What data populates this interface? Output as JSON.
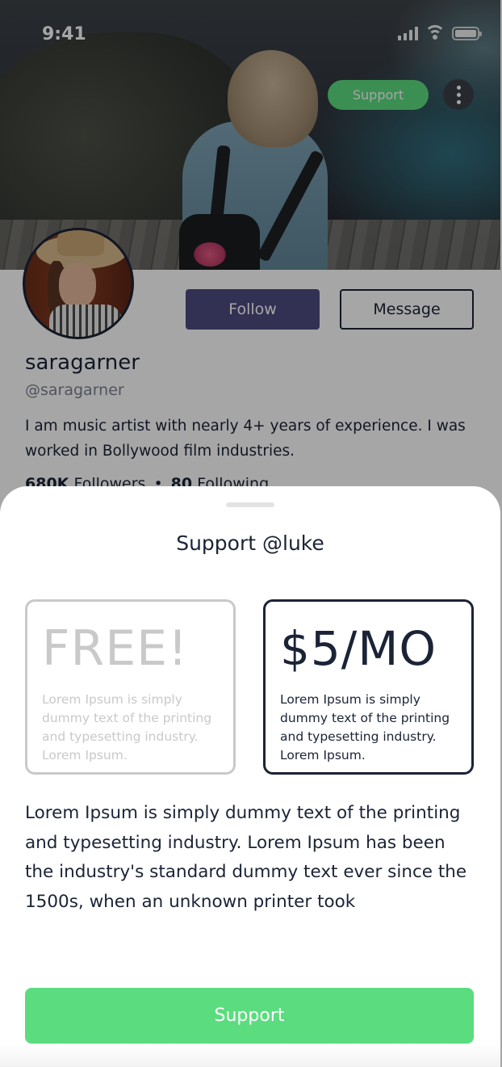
{
  "status_bar": {
    "time": "9:41"
  },
  "cover": {
    "support_label": "Support"
  },
  "profile": {
    "follow_label": "Follow",
    "message_label": "Message",
    "name": "saragarner",
    "handle": "@saragarner",
    "bio": "I am music artist with nearly 4+ years of experience. I was worked in Bollywood film industries.",
    "followers": "680K",
    "followers_label": "Followers",
    "separator": "•",
    "following": "80",
    "following_label": "Following"
  },
  "sheet": {
    "title": "Support @luke",
    "plans": [
      {
        "price": "FREE!",
        "description": "Lorem Ipsum is simply dummy text of the printing and typesetting industry. Lorem Ipsum.",
        "selected": false
      },
      {
        "price": "$5/MO",
        "description": "Lorem Ipsum is simply dummy text of the printing and typesetting industry. Lorem Ipsum.",
        "selected": true
      }
    ],
    "body": "Lorem Ipsum is simply dummy text of the printing and typesetting industry. Lorem Ipsum has been the industry's standard dummy text ever since the 1500s, when an unknown printer took",
    "support_label": "Support"
  },
  "colors": {
    "accent_green": "#5bdc7f",
    "follow_purple": "#4e4b80",
    "text_dark": "#1b2336",
    "muted_gray": "#c9c9c9"
  },
  "icons": [
    "signal-icon",
    "wifi-icon",
    "battery-icon",
    "more-vertical-icon"
  ]
}
